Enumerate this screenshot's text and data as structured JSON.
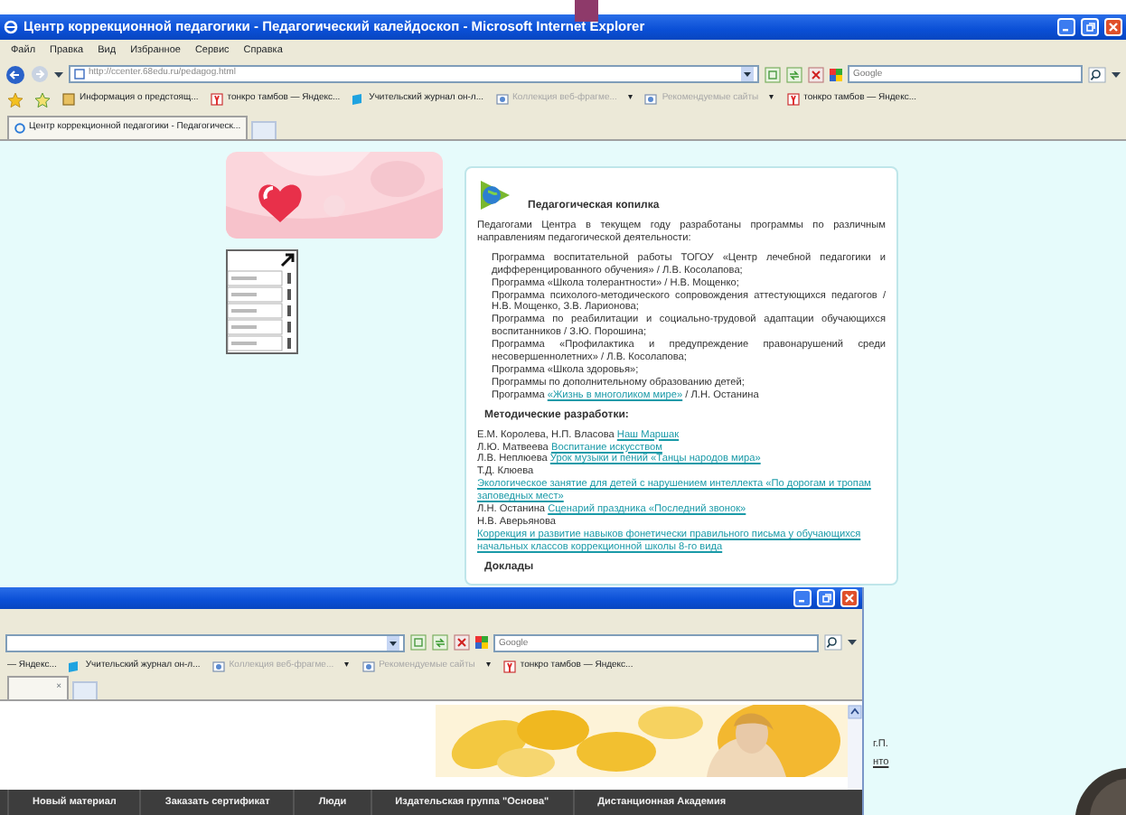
{
  "top_window": {
    "title": "Центр коррекционной педагогики - Педагогический калейдоскоп - Microsoft Internet Explorer",
    "menu": [
      "Файл",
      "Правка",
      "Вид",
      "Избранное",
      "Сервис",
      "Справка"
    ],
    "address": "http://ccenter.68edu.ru/pedagog.html",
    "search_placeholder": "Google",
    "favorites": [
      {
        "kind": "page",
        "label": "Информация о предстоящ...",
        "dimmed": false
      },
      {
        "kind": "yandex",
        "label": "тонкро тамбов — Яндекс...",
        "dimmed": false
      },
      {
        "kind": "journal",
        "label": "Учительский журнал он-л...",
        "dimmed": false
      },
      {
        "kind": "webslice",
        "label": "Коллекция веб-фрагме...",
        "dimmed": true,
        "arrow": "▾"
      },
      {
        "kind": "webslice",
        "label": "Рекомендуемые сайты",
        "dimmed": true,
        "arrow": "▾"
      },
      {
        "kind": "yandex",
        "label": "тонкро тамбов — Яндекс...",
        "dimmed": false
      }
    ],
    "tab": "Центр коррекционной педагогики - Педагогическ...",
    "article": {
      "title": "Педагогическая копилка",
      "intro": "Педагогами Центра в текущем году разработаны программы по различным направлениям педагогической деятельности:",
      "programs": [
        {
          "before": "Программа воспитательной работы ТОГОУ «Центр лечебной педагогики и дифференцированного обучения» / Л.В. Косолапова;"
        },
        {
          "before": "Программа «Школа толерантности» / Н.В. Мощенко;"
        },
        {
          "before": "Программа психолого-методического сопровождения аттестующихся педагогов / Н.В. Мощенко, З.В. Ларионова;"
        },
        {
          "before": "Программа по реабилитации и социально-трудовой адаптации обучающихся воспитанников / З.Ю. Порошина;"
        },
        {
          "before": "Программа «Профилактика и предупреждение правонарушений среди несовершеннолетних» / Л.В. Косолапова;"
        },
        {
          "before": "Программа «Школа здоровья»;"
        },
        {
          "before": "Программы по дополнительному образованию детей;"
        },
        {
          "before": "Программа",
          "link": "«Жизнь в многоликом мире»",
          "after": "/ Л.Н. Останина"
        }
      ],
      "methods_heading": "Методические разработки:",
      "methods": [
        {
          "before": "Е.М. Королева, Н.П. Власова",
          "link": "Наш Маршак"
        },
        {
          "before": "Л.Ю. Матвеева",
          "link": "Воспитание искусством"
        },
        {
          "before": "Л.В. Неплюева",
          "link": "Урок музыки и пений «Танцы народов мира»"
        },
        {
          "before": "Т.Д. Клюева",
          "link": "Экологическое занятие для детей с нарушением интеллекта «По дорогам и тропам заповедных мест»"
        },
        {
          "before": "Л.Н. Останина",
          "link": "Сценарий праздника «Последний звонок»"
        },
        {
          "before": "Н.В. Аверьянова",
          "link": "Коррекция и развитие навыков фонетически правильного письма у обучающихся начальных классов коррекционной школы 8-го вида"
        }
      ],
      "reports_heading": "Доклады"
    },
    "fragments": [
      {
        "text": "г.П.",
        "link": false
      },
      {
        "text": "нто",
        "link": true
      }
    ]
  },
  "bottom_window": {
    "search_placeholder": "Google",
    "favorites": [
      {
        "kind": "none",
        "label": "— Яндекс...",
        "dimmed": false
      },
      {
        "kind": "journal",
        "label": "Учительский журнал он-л...",
        "dimmed": false
      },
      {
        "kind": "webslice",
        "label": "Коллекция веб-фрагме...",
        "dimmed": true,
        "arrow": "▾"
      },
      {
        "kind": "webslice",
        "label": "Рекомендуемые сайты",
        "dimmed": true,
        "arrow": "▾"
      },
      {
        "kind": "yandex",
        "label": "тонкро тамбов — Яндекс...",
        "dimmed": false
      }
    ],
    "tab_close": "×",
    "nav": [
      "Новый материал",
      "Заказать сертификат",
      "Люди",
      "Издательская группа \"Основа\"",
      "Дистанционная Академия"
    ]
  }
}
